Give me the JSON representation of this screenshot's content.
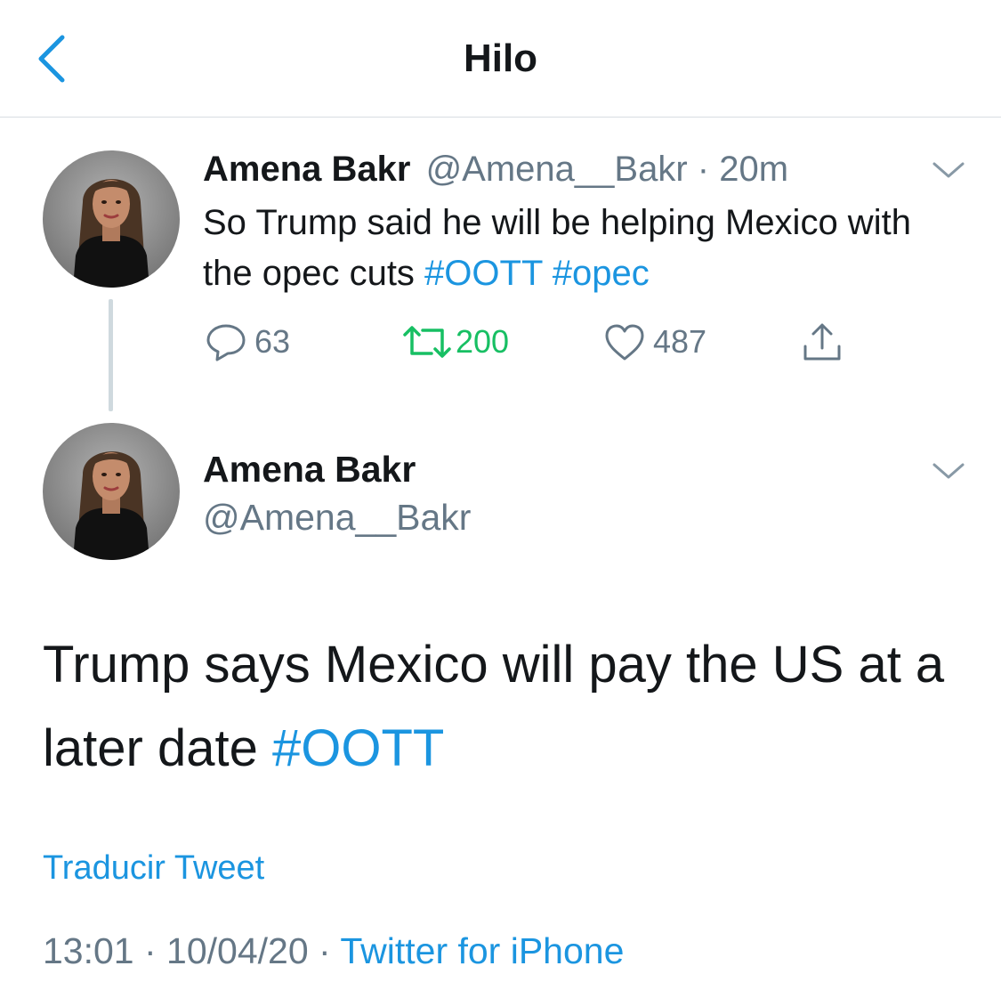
{
  "header": {
    "title": "Hilo",
    "back_icon": "chevron-left-icon"
  },
  "colors": {
    "accent": "#1b95e0",
    "muted": "#657786",
    "retweet_active": "#17bf63",
    "divider": "#d8dde2",
    "text": "#14171a"
  },
  "tweet1": {
    "author_name": "Amena Bakr",
    "handle": "@Amena__Bakr",
    "separator": " · ",
    "time_ago": "20m",
    "text_prefix": "So Trump said he will be helping Mexico with the opec cuts ",
    "hashtag1": "#OOTT",
    "hashtag2": "#opec",
    "actions": {
      "replies": "63",
      "retweets": "200",
      "likes": "487"
    }
  },
  "tweet2": {
    "author_name": "Amena Bakr",
    "handle": "@Amena__Bakr",
    "text_prefix": "Trump says Mexico will pay the US at a later date ",
    "hashtag": "#OOTT",
    "translate_label": "Traducir Tweet",
    "time": "13:01",
    "date": "10/04/20",
    "separator": " · ",
    "source": "Twitter for iPhone"
  }
}
